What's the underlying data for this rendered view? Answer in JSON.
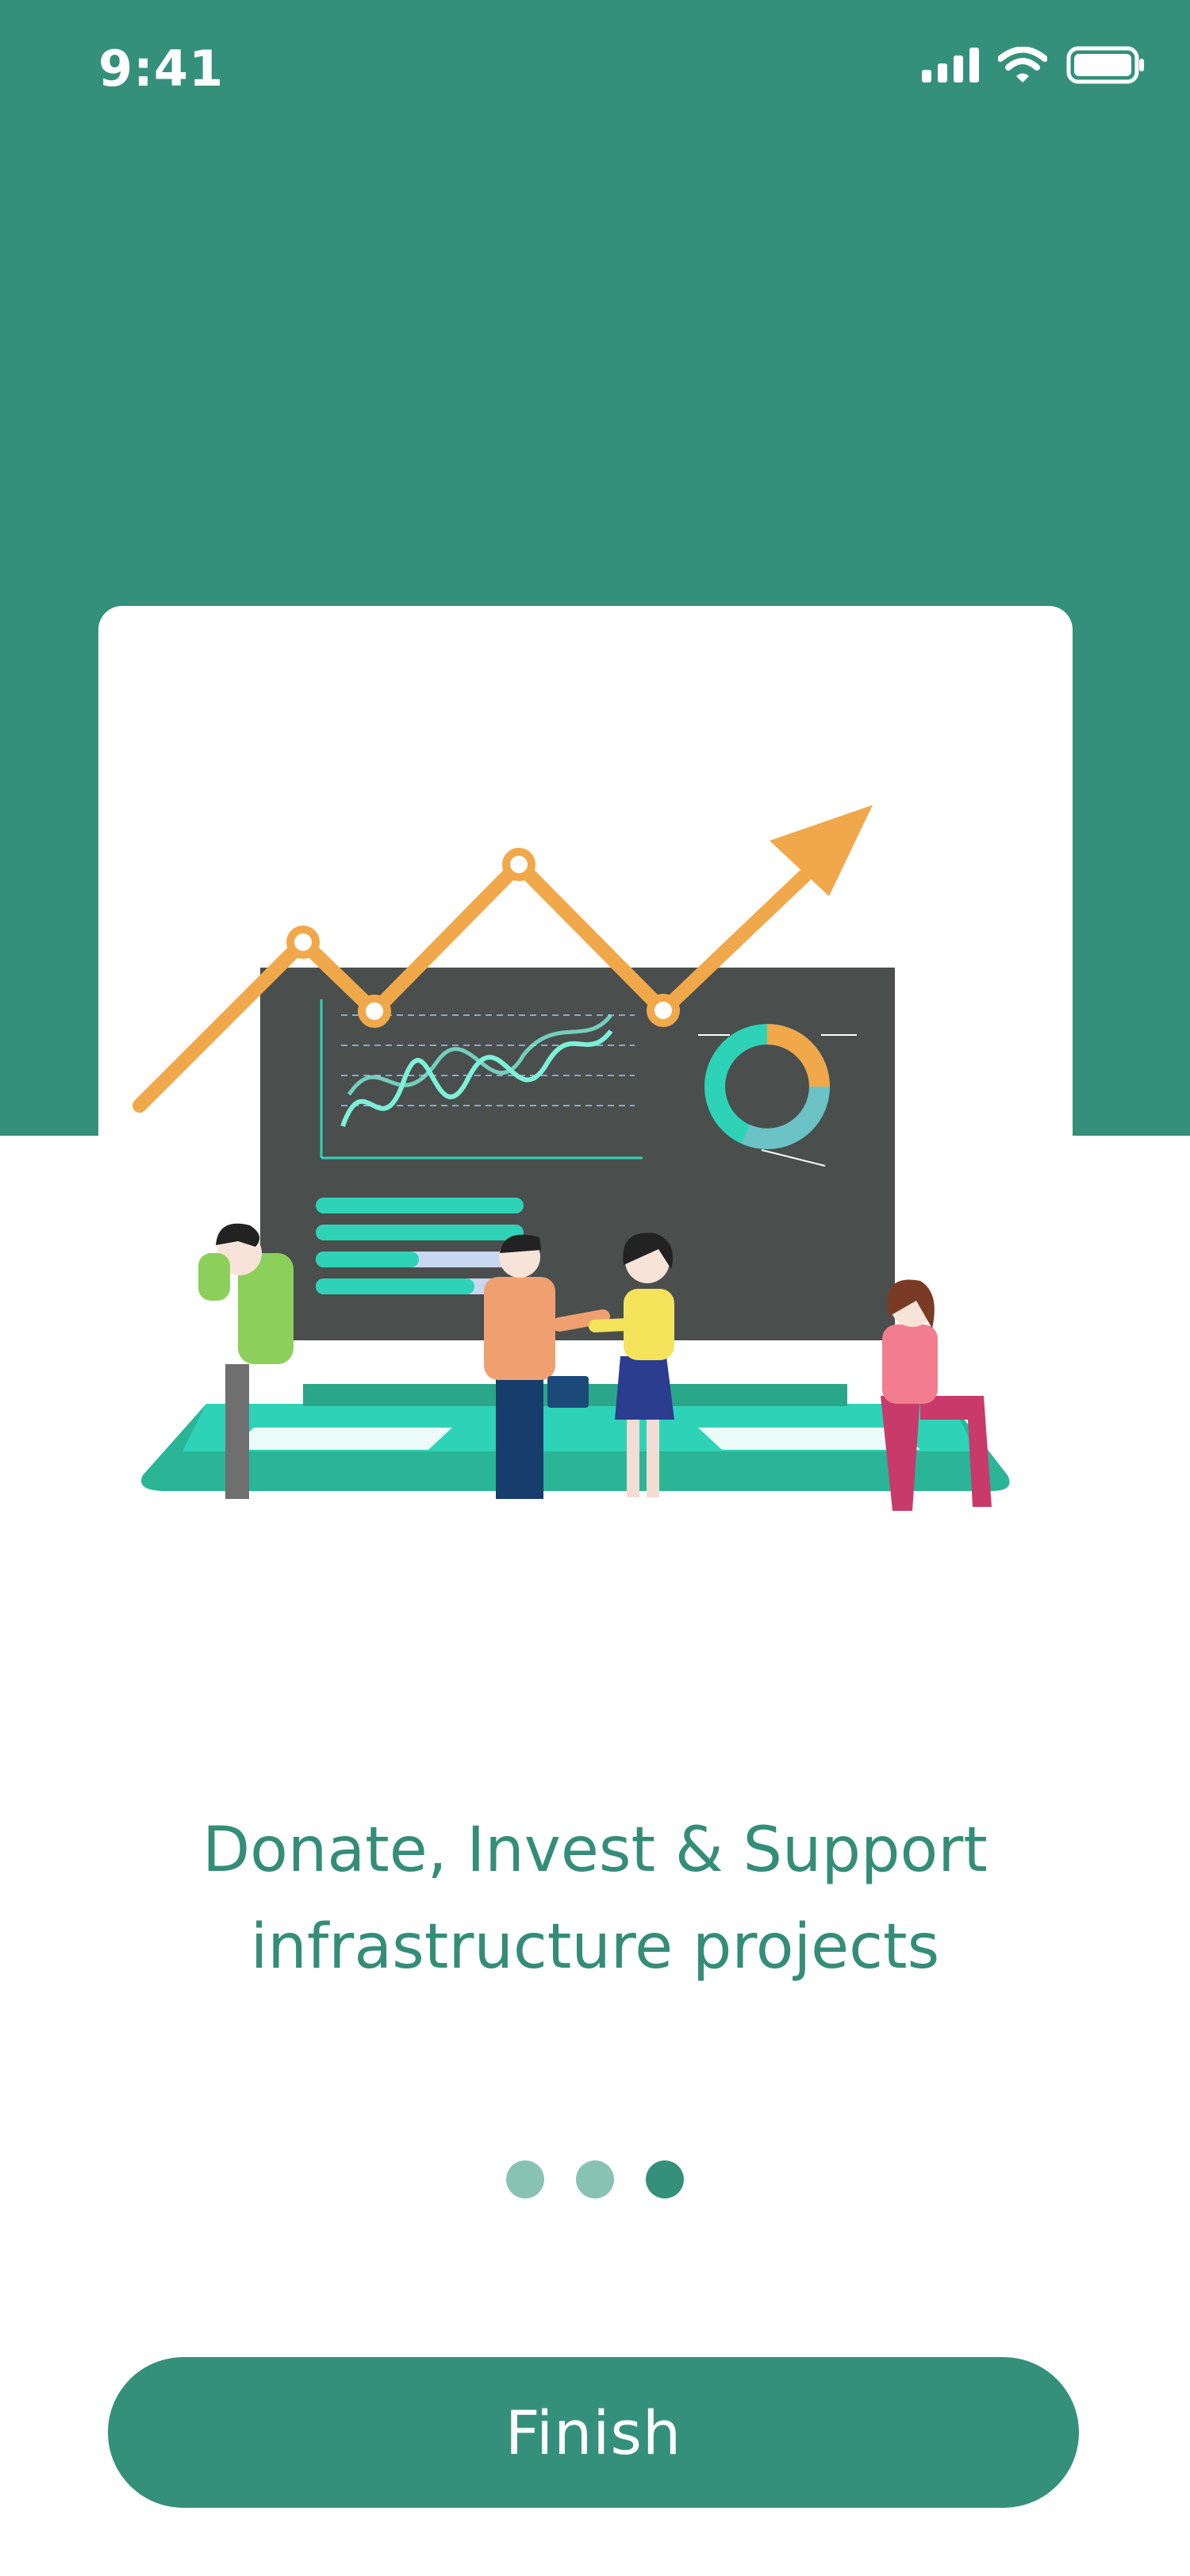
{
  "status_bar": {
    "time": "9:41",
    "icons": [
      "signal-icon",
      "wifi-icon",
      "battery-icon"
    ]
  },
  "onboarding": {
    "illustration": "growth-chart-illustration",
    "headline_line1": "Donate, Invest & Support",
    "headline_line2": "infrastructure projects",
    "page_indicator": {
      "count": 3,
      "active_index": 2
    },
    "finish_label": "Finish"
  },
  "colors": {
    "primary": "#35907b",
    "dot_inactive": "#88c2b3",
    "accent_orange": "#f0a84a",
    "accent_teal": "#2ed3b7",
    "board": "#4a4e4d"
  }
}
